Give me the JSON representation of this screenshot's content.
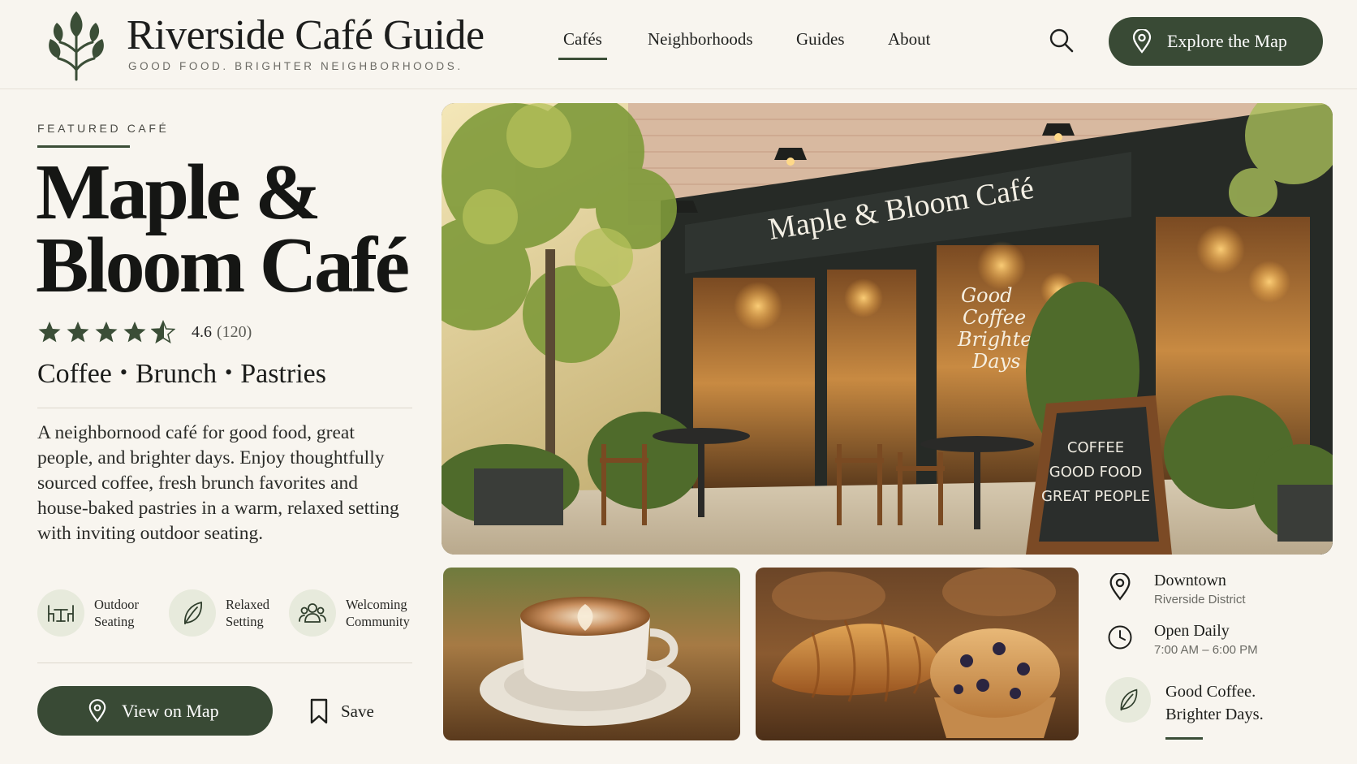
{
  "brand": {
    "title": "Riverside Café Guide",
    "tagline": "GOOD FOOD. BRIGHTER NEIGHBORHOODS.",
    "logo_icon": "leaf-sprig-icon",
    "accent_color": "#394a35"
  },
  "nav": {
    "items": [
      {
        "label": "Cafés",
        "active": true
      },
      {
        "label": "Neighborhoods",
        "active": false
      },
      {
        "label": "Guides",
        "active": false
      },
      {
        "label": "About",
        "active": false
      }
    ],
    "search_icon": "search-icon",
    "explore_label": "Explore the Map",
    "explore_icon": "map-pin-icon"
  },
  "featured": {
    "eyebrow": "FEATURED CAFÉ",
    "name_line1": "Maple &",
    "name_line2": "Bloom Café",
    "rating_value": "4.6",
    "rating_count": "(120)",
    "rating_stars": 4.6,
    "categories": [
      "Coffee",
      "Brunch",
      "Pastries"
    ],
    "category_separator": "•",
    "description": "A neighbornood café for good food, great people, and brighter days. Enjoy thoughtfully sourced coffee, fresh brunch favorites and house-baked pastries in a warm, relaxed setting with inviting outdoor seating.",
    "amenities": [
      {
        "line1": "Outdoor",
        "line2": "Seating",
        "icon": "outdoor-seating-icon"
      },
      {
        "line1": "Relaxed",
        "line2": "Setting",
        "icon": "leaf-icon"
      },
      {
        "line1": "Welcoming",
        "line2": "Community",
        "icon": "community-icon"
      }
    ],
    "map_button": "View on Map",
    "save_button": "Save"
  },
  "hero_image": {
    "storefront_sign": "Maple & Bloom Café",
    "window_text": [
      "Good",
      "Coffee",
      "Brighter",
      "Days"
    ],
    "chalkboard": [
      "COFFEE",
      "GOOD FOOD",
      "GREAT PEOPLE"
    ]
  },
  "info": {
    "location_title": "Downtown",
    "location_sub": "Riverside District",
    "hours_title": "Open Daily",
    "hours_sub": "7:00 AM – 6:00 PM",
    "motto_line1": "Good Coffee.",
    "motto_line2": "Brighter Days."
  }
}
